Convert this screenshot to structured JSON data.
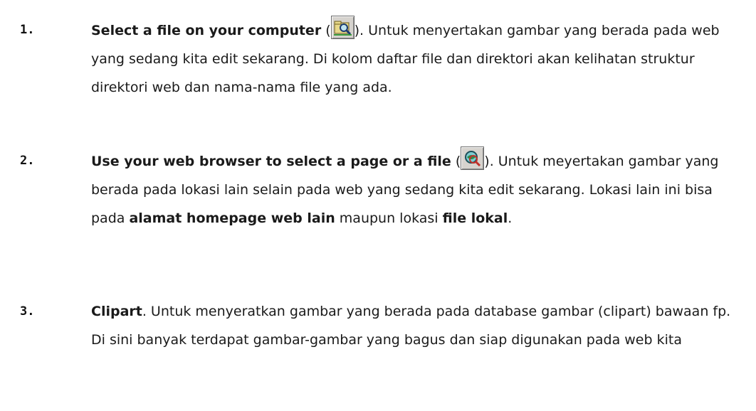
{
  "items": [
    {
      "number": "1.",
      "bold_title": "Select a file on your computer",
      "paren_open": " (",
      "icon": "folder-search-icon",
      "paren_close": ").",
      "text": " Untuk menyertakan gambar yang berada pada web  yang sedang kita edit sekarang. Di kolom daftar file dan direktori akan kelihatan struktur direktori web dan nama-nama file yang ada."
    },
    {
      "number": "2.",
      "bold_title": "Use your web browser  to select a page or a file",
      "paren_open": " (",
      "icon": "browse-web-icon",
      "paren_close": ").",
      "text_a": " Untuk meyertakan gambar yang berada pada lokasi lain selain pada web yang sedang kita edit sekarang. Lokasi lain ini bisa pada ",
      "bold_a": "alamat homepage web lain",
      "text_b": " maupun lokasi ",
      "bold_b": "file lokal",
      "text_c": "."
    },
    {
      "number": "3.",
      "bold_title": "Clipart",
      "text": ". Untuk menyeratkan gambar yang berada pada database gambar (clipart) bawaan fp. Di sini banyak terdapat gambar-gambar yang bagus dan siap digunakan pada web kita"
    }
  ]
}
